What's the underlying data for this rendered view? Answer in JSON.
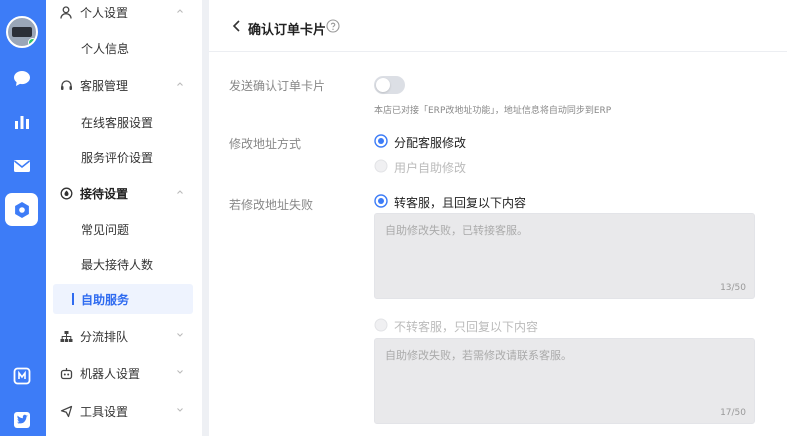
{
  "colors": {
    "primary": "#3d7cf7",
    "accent": "#2f6bf0",
    "selected_bg": "#eef3fe",
    "online": "#31c46b"
  },
  "rail": {
    "icons": [
      "chat-bubble-icon",
      "bar-chart-icon",
      "mail-icon",
      "settings-gear-icon",
      "notebook-icon",
      "bird-icon"
    ],
    "active": "settings-gear-icon"
  },
  "menu": {
    "groups": [
      {
        "label": "个人设置",
        "icon": "user-icon",
        "expanded": true,
        "items": [
          {
            "label": "个人信息"
          }
        ]
      },
      {
        "label": "客服管理",
        "icon": "headset-icon",
        "expanded": true,
        "items": [
          {
            "label": "在线客服设置"
          },
          {
            "label": "服务评价设置"
          }
        ]
      },
      {
        "label": "接待设置",
        "icon": "flame-icon",
        "expanded": true,
        "items": [
          {
            "label": "常见问题"
          },
          {
            "label": "最大接待人数"
          },
          {
            "label": "自助服务",
            "selected": true
          }
        ]
      },
      {
        "label": "分流排队",
        "icon": "hierarchy-icon",
        "expanded": false,
        "items": []
      },
      {
        "label": "机器人设置",
        "icon": "robot-icon",
        "expanded": false,
        "items": []
      },
      {
        "label": "工具设置",
        "icon": "send-icon",
        "expanded": false,
        "items": []
      }
    ]
  },
  "page": {
    "title": "确认订单卡片",
    "send_card": {
      "label": "发送确认订单卡片",
      "enabled": false,
      "note": "本店已对接「ERP改地址功能」，地址信息将自动同步到ERP"
    },
    "modify_method": {
      "label": "修改地址方式",
      "options": [
        {
          "label": "分配客服修改",
          "selected": true
        },
        {
          "label": "用户自助修改",
          "selected": false
        }
      ]
    },
    "on_failure": {
      "label": "若修改地址失败",
      "options": [
        {
          "label": "转客服，且回复以下内容",
          "selected": true,
          "text": "自助修改失败，已转接客服。",
          "count": "13/50"
        },
        {
          "label": "不转客服，只回复以下内容",
          "selected": false,
          "text": "自助修改失败，若需修改请联系客服。",
          "count": "17/50"
        }
      ]
    }
  }
}
